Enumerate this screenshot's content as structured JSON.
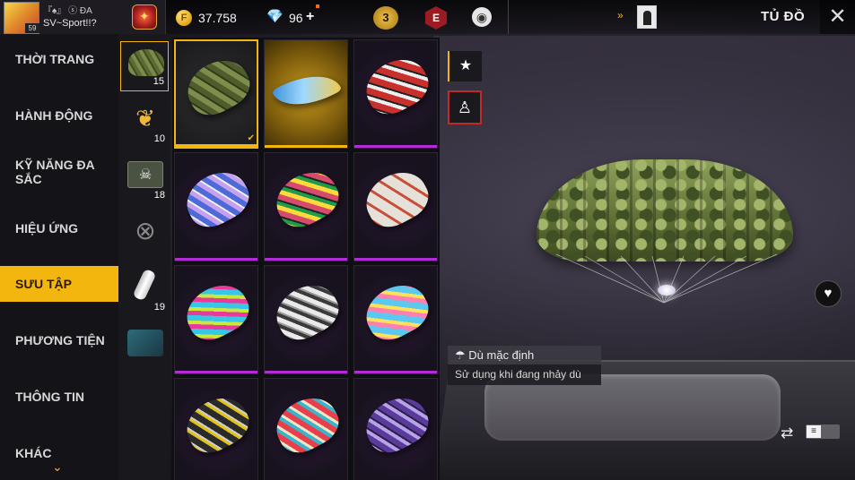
{
  "profile": {
    "level": "59",
    "tags": "『♠』 ⓢ ĐA",
    "name": "SV~Sport!!?"
  },
  "currency": {
    "coins": "37.758",
    "coin_symbol": "F",
    "diamonds": "96",
    "diamond_plus": "+"
  },
  "header": {
    "season_level": "3",
    "elite_letter": "E",
    "title": "TỦ ĐỒ"
  },
  "menu": {
    "items": [
      {
        "label": "THỜI TRANG"
      },
      {
        "label": "HÀNH ĐỘNG"
      },
      {
        "label": "KỸ NĂNG ĐA SẮC"
      },
      {
        "label": "HIỆU ỨNG"
      },
      {
        "label": "SƯU TẬP"
      },
      {
        "label": "PHƯƠNG TIỆN"
      },
      {
        "label": "THÔNG TIN"
      },
      {
        "label": "KHÁC"
      }
    ],
    "active_index": 4
  },
  "subcategories": [
    {
      "icon": "parachute-icon",
      "count": "15"
    },
    {
      "icon": "wings-icon",
      "count": "10"
    },
    {
      "icon": "airdrop-box-icon",
      "count": "18"
    },
    {
      "icon": "emblem-icon",
      "count": ""
    },
    {
      "icon": "glow-stick-icon",
      "count": "19"
    },
    {
      "icon": "vehicle-icon",
      "count": ""
    }
  ],
  "grid": {
    "items": [
      {
        "name": "parachute-camo",
        "colors": [
          "#4f5d2c",
          "#7f8d4c"
        ]
      },
      {
        "name": "glider-wings",
        "colors": [
          "#3d8fd6",
          "#f2c94a"
        ]
      },
      {
        "name": "parachute-red-graffiti",
        "colors": [
          "#c9302c",
          "#eeeeee"
        ]
      },
      {
        "name": "parachute-blue-purple",
        "colors": [
          "#4d6bd8",
          "#c6a0f0"
        ]
      },
      {
        "name": "parachute-tribal-color",
        "colors": [
          "#d64a6c",
          "#ffd83a"
        ]
      },
      {
        "name": "parachute-white-red",
        "colors": [
          "#e6e1d8",
          "#c6503a"
        ]
      },
      {
        "name": "parachute-neon-mix",
        "colors": [
          "#38c6e8",
          "#e83a9a"
        ]
      },
      {
        "name": "parachute-bw-graffiti",
        "colors": [
          "#e9e9e9",
          "#3a3a3a"
        ]
      },
      {
        "name": "parachute-pastel-graffiti",
        "colors": [
          "#5ac8ef",
          "#ff7fb0"
        ]
      },
      {
        "name": "parachute-black-yellow",
        "colors": [
          "#2a2a2a",
          "#e0c21a"
        ]
      },
      {
        "name": "parachute-tiger-stripes",
        "colors": [
          "#e83f4a",
          "#3bb3c9"
        ]
      },
      {
        "name": "parachute-purple-wave",
        "colors": [
          "#5a3a9a",
          "#b7a2e8"
        ]
      }
    ]
  },
  "info": {
    "icon": "parachute-small-icon",
    "title": "Dù mặc định",
    "description": "Sử dụng khi đang nhảy dù"
  },
  "colors": {
    "accent": "#f2b60f",
    "rarity_purple": "#b12bd6",
    "close_red": "#c22a2a"
  }
}
